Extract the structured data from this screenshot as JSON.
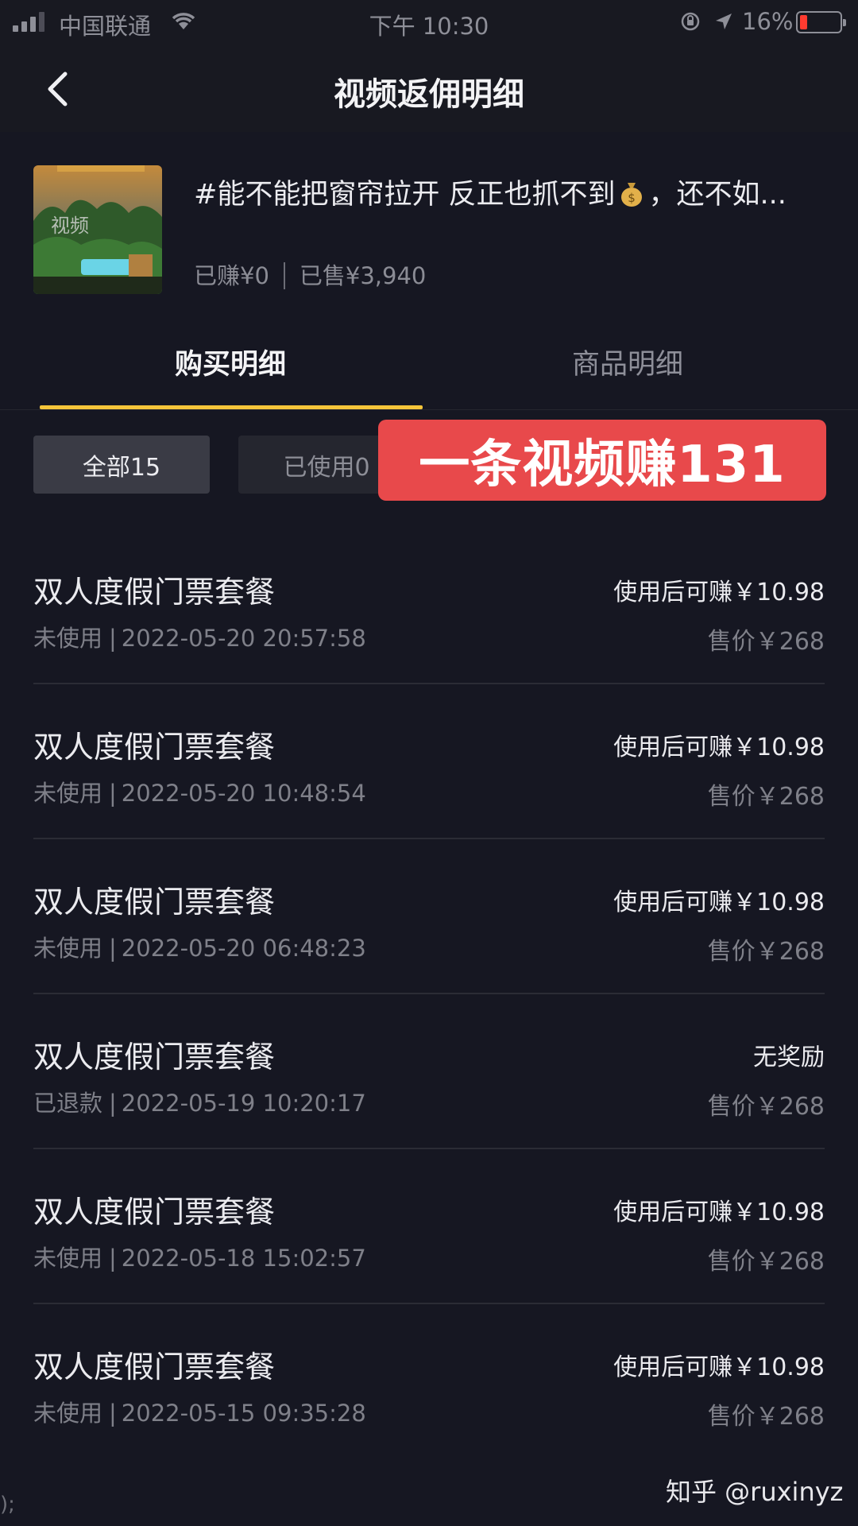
{
  "status_bar": {
    "carrier": "中国联通",
    "time": "下午 10:30",
    "battery_pct": "16%",
    "battery_level": 0.16,
    "battery_color": "#ff3b30"
  },
  "header": {
    "title": "视频返佣明细",
    "back_icon": "chevron-left-icon"
  },
  "video": {
    "thumb_label": "视频",
    "title_before": "#能不能把窗帘拉开 反正也抓不到",
    "title_after": "，还不如...",
    "emoji_icon": "money-bag-icon",
    "earned": "已赚¥0",
    "sold": "已售¥3,940"
  },
  "tabs": [
    {
      "label": "购买明细",
      "active": true
    },
    {
      "label": "商品明细",
      "active": false
    }
  ],
  "filters": [
    {
      "label": "全部15",
      "active": true
    },
    {
      "label": "已使用0",
      "active": false
    }
  ],
  "promo_banner": "一条视频赚131",
  "orders": [
    {
      "name": "双人度假门票套餐",
      "status": "未使用",
      "datetime": "2022-05-20 20:57:58",
      "reward": "使用后可赚￥10.98",
      "price": "售价￥268"
    },
    {
      "name": "双人度假门票套餐",
      "status": "未使用",
      "datetime": "2022-05-20 10:48:54",
      "reward": "使用后可赚￥10.98",
      "price": "售价￥268"
    },
    {
      "name": "双人度假门票套餐",
      "status": "未使用",
      "datetime": "2022-05-20 06:48:23",
      "reward": "使用后可赚￥10.98",
      "price": "售价￥268"
    },
    {
      "name": "双人度假门票套餐",
      "status": "已退款",
      "datetime": "2022-05-19 10:20:17",
      "reward": "无奖励",
      "price": "售价￥268"
    },
    {
      "name": "双人度假门票套餐",
      "status": "未使用",
      "datetime": "2022-05-18 15:02:57",
      "reward": "使用后可赚￥10.98",
      "price": "售价￥268"
    },
    {
      "name": "双人度假门票套餐",
      "status": "未使用",
      "datetime": "2022-05-15 09:35:28",
      "reward": "使用后可赚￥10.98",
      "price": "售价￥268"
    }
  ],
  "colors": {
    "background": "#161722",
    "tab_indicator": "#f5c53a",
    "promo_banner": "#e8494b"
  },
  "watermark": "知乎 @ruxinyz",
  "edge_mark": ");"
}
